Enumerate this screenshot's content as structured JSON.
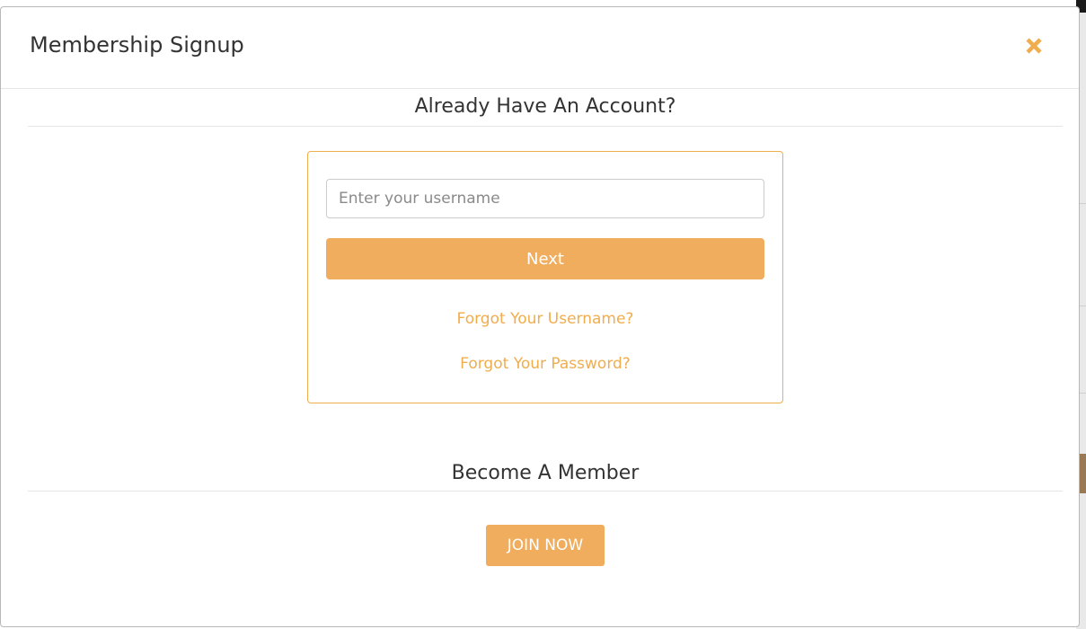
{
  "modal": {
    "title": "Membership Signup",
    "close_icon": "close-x-icon",
    "close_glyph": "✖"
  },
  "login": {
    "heading": "Already Have An Account?",
    "username_placeholder": "Enter your username",
    "username_value": "",
    "next_label": "Next",
    "forgot_username": "Forgot Your Username?",
    "forgot_password": "Forgot Your Password?"
  },
  "signup": {
    "heading": "Become A Member",
    "join_label": "JOIN NOW"
  },
  "colors": {
    "accent": "#f0ad4e",
    "button_fill": "#f0ad5e",
    "text": "#333333"
  }
}
